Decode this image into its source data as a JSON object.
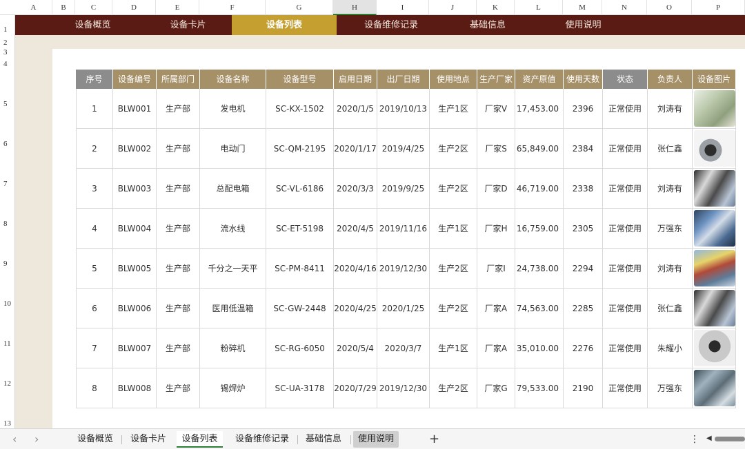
{
  "columns": [
    "A",
    "B",
    "C",
    "D",
    "E",
    "F",
    "G",
    "H",
    "I",
    "J",
    "K",
    "L",
    "M",
    "N",
    "O",
    "P"
  ],
  "rows": [
    "1",
    "2",
    "3",
    "4",
    "5",
    "6",
    "7",
    "8",
    "9",
    "10",
    "11",
    "12",
    "13"
  ],
  "nav": {
    "items": [
      {
        "label": "设备概览",
        "active": false
      },
      {
        "label": "设备卡片",
        "active": false
      },
      {
        "label": "设备列表",
        "active": true
      },
      {
        "label": "设备维修记录",
        "active": false
      },
      {
        "label": "基础信息",
        "active": false
      },
      {
        "label": "使用说明",
        "active": false
      }
    ]
  },
  "table": {
    "headers": [
      "序号",
      "设备编号",
      "所属部门",
      "设备名称",
      "设备型号",
      "启用日期",
      "出厂日期",
      "使用地点",
      "生产厂家",
      "资产原值",
      "使用天数",
      "状态",
      "负责人",
      "设备图片"
    ],
    "rows": [
      {
        "no": "1",
        "code": "BLW001",
        "dept": "生产部",
        "name": "发电机",
        "model": "SC-KX-1502",
        "start": "2020/1/5",
        "made": "2019/10/13",
        "place": "生产1区",
        "maker": "厂家V",
        "value": "17,453.00",
        "days": "2396",
        "status": "正常使用",
        "owner": "刘涛有",
        "image_icon": "generator-icon"
      },
      {
        "no": "2",
        "code": "BLW002",
        "dept": "生产部",
        "name": "电动门",
        "model": "SC-QM-2195",
        "start": "2020/1/17",
        "made": "2019/4/25",
        "place": "生产2区",
        "maker": "厂家S",
        "value": "65,849.00",
        "days": "2384",
        "status": "正常使用",
        "owner": "张仁鑫",
        "image_icon": "door-machine-icon"
      },
      {
        "no": "3",
        "code": "BLW003",
        "dept": "生产部",
        "name": "总配电箱",
        "model": "SC-VL-6186",
        "start": "2020/3/3",
        "made": "2019/9/25",
        "place": "生产2区",
        "maker": "厂家D",
        "value": "46,719.00",
        "days": "2338",
        "status": "正常使用",
        "owner": "刘涛有",
        "image_icon": "machine-icon"
      },
      {
        "no": "4",
        "code": "BLW004",
        "dept": "生产部",
        "name": "流水线",
        "model": "SC-ET-5198",
        "start": "2020/4/5",
        "made": "2019/11/16",
        "place": "生产1区",
        "maker": "厂家H",
        "value": "16,759.00",
        "days": "2305",
        "status": "正常使用",
        "owner": "万强东",
        "image_icon": "assembly-line-icon"
      },
      {
        "no": "5",
        "code": "BLW005",
        "dept": "生产部",
        "name": "千分之一天平",
        "model": "SC-PM-8411",
        "start": "2020/4/16",
        "made": "2019/12/30",
        "place": "生产2区",
        "maker": "厂家I",
        "value": "24,738.00",
        "days": "2294",
        "status": "正常使用",
        "owner": "刘涛有",
        "image_icon": "factory-icon"
      },
      {
        "no": "6",
        "code": "BLW006",
        "dept": "生产部",
        "name": "医用低温箱",
        "model": "SC-GW-2448",
        "start": "2020/4/25",
        "made": "2020/1/25",
        "place": "生产2区",
        "maker": "厂家A",
        "value": "74,563.00",
        "days": "2285",
        "status": "正常使用",
        "owner": "张仁鑫",
        "image_icon": "machine-icon"
      },
      {
        "no": "7",
        "code": "BLW007",
        "dept": "生产部",
        "name": "粉碎机",
        "model": "SC-RG-6050",
        "start": "2020/5/4",
        "made": "2020/3/7",
        "place": "生产1区",
        "maker": "厂家A",
        "value": "35,010.00",
        "days": "2276",
        "status": "正常使用",
        "owner": "朱耀小",
        "image_icon": "crusher-icon"
      },
      {
        "no": "8",
        "code": "BLW008",
        "dept": "生产部",
        "name": "锡焊炉",
        "model": "SC-UA-3178",
        "start": "2020/7/29",
        "made": "2019/12/30",
        "place": "生产2区",
        "maker": "厂家G",
        "value": "79,533.00",
        "days": "2190",
        "status": "正常使用",
        "owner": "万强东",
        "image_icon": "furnace-icon"
      }
    ]
  },
  "tabs": {
    "items": [
      {
        "label": "设备概览",
        "style": "normal"
      },
      {
        "label": "设备卡片",
        "style": "normal"
      },
      {
        "label": "设备列表",
        "style": "active"
      },
      {
        "label": "设备维修记录",
        "style": "normal"
      },
      {
        "label": "基础信息",
        "style": "normal"
      },
      {
        "label": "使用说明",
        "style": "grey"
      }
    ],
    "prev_icon": "chevron-left-icon",
    "next_icon": "chevron-right-icon",
    "add_icon": "plus-icon",
    "more_icon": "more-vertical-icon"
  },
  "colors": {
    "nav_bg": "#5a1b14",
    "nav_active": "#c5a030",
    "header_gold": "#a69068",
    "header_grey": "#8c8c8c",
    "band": "#ede7dc"
  }
}
